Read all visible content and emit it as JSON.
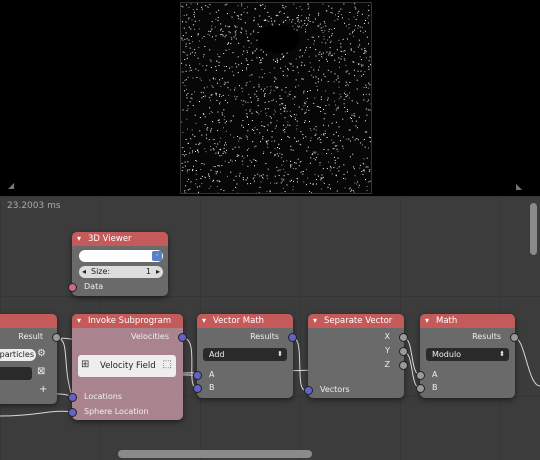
{
  "timing": "23.2003 ms",
  "nodes": {
    "viewer": {
      "title": "3D Viewer",
      "size_label": "Size:",
      "size_value": "1",
      "data_label": "Data"
    },
    "left_partial": {
      "result_label": "Result",
      "particles_label": "particles"
    },
    "invoke": {
      "title": "Invoke Subprogram",
      "velocities_label": "Velocities",
      "subprogram_label": "Velocity Field",
      "locations_label": "Locations",
      "sphere_label": "Sphere Location"
    },
    "vector_math": {
      "title": "Vector Math",
      "results_label": "Results",
      "mode": "Add",
      "a_label": "A",
      "b_label": "B"
    },
    "separate": {
      "title": "Separate Vector",
      "x_label": "X",
      "y_label": "Y",
      "z_label": "Z",
      "vectors_label": "Vectors"
    },
    "math": {
      "title": "Math",
      "results_label": "Results",
      "mode": "Modulo",
      "a_label": "A",
      "b_label": "B"
    }
  },
  "colors": {
    "header": "#c45a5a",
    "node_body": "#6a6a6a",
    "invoke_body": "#a9848f",
    "socket_vector": "#6363c7",
    "socket_data": "#c96a86"
  }
}
